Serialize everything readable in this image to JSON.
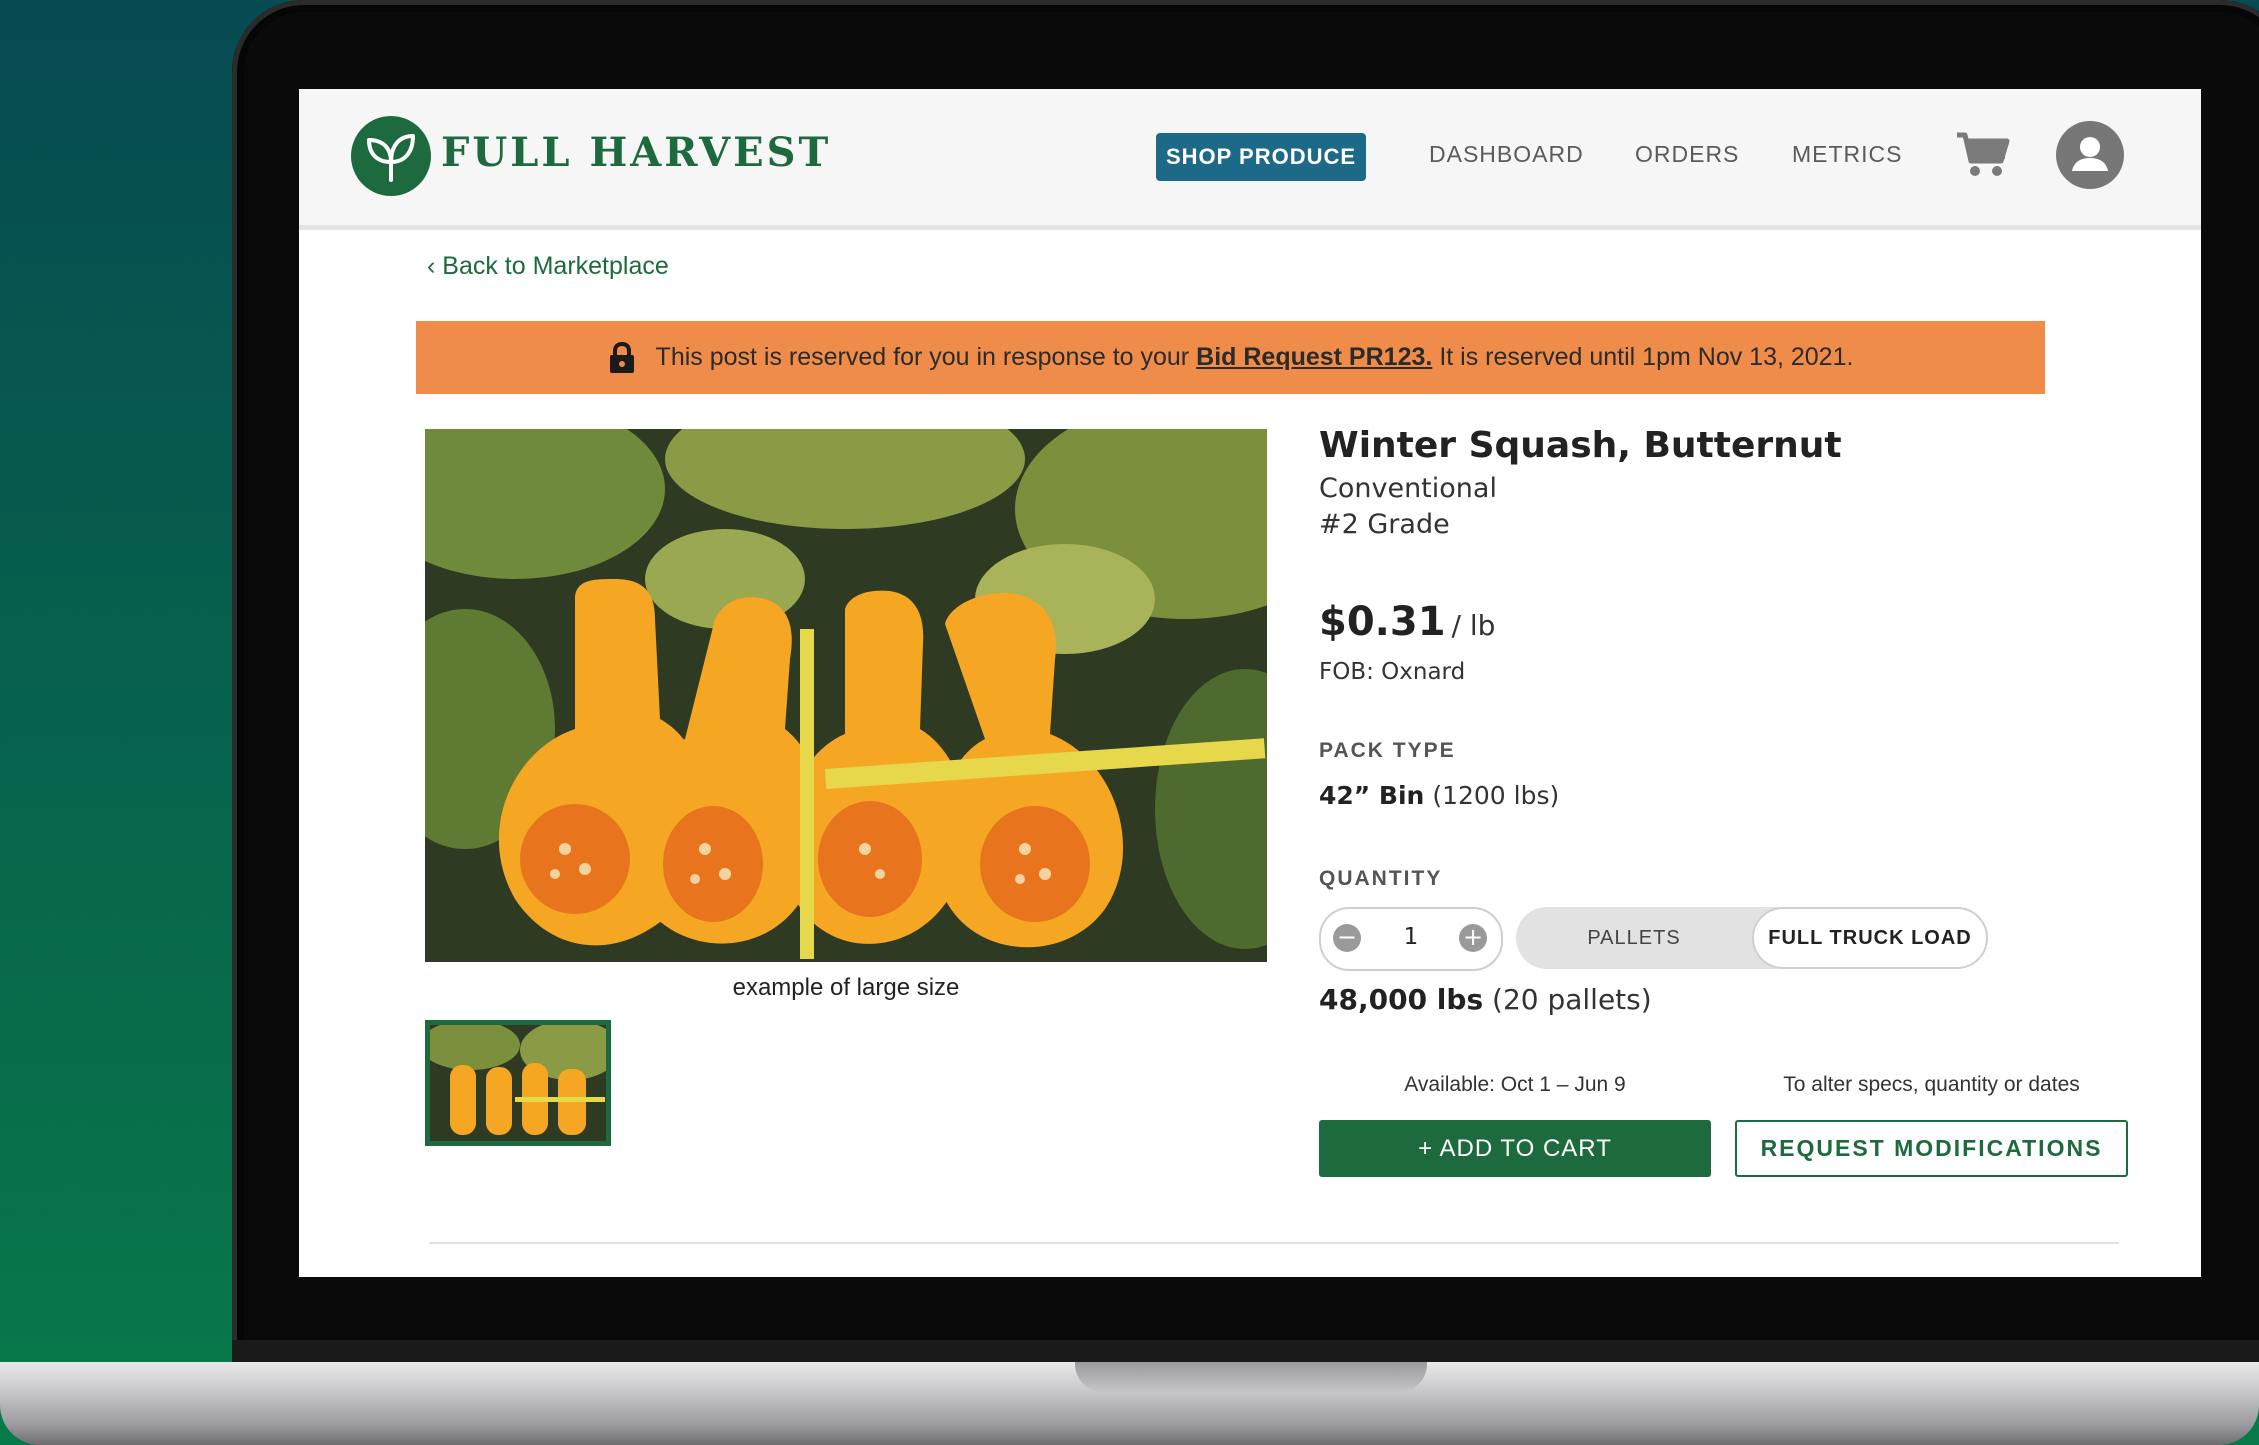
{
  "brand": {
    "name": "FULL HARVEST",
    "color": "#1e6a3f"
  },
  "nav": {
    "items": [
      {
        "label": "SHOP PRODUCE",
        "active": true
      },
      {
        "label": "DASHBOARD",
        "active": false
      },
      {
        "label": "ORDERS",
        "active": false
      },
      {
        "label": "METRICS",
        "active": false
      }
    ],
    "cart_icon": "cart-icon",
    "avatar_icon": "user-avatar-icon"
  },
  "back_link": "‹ Back to Marketplace",
  "banner": {
    "icon": "lock-icon",
    "text_before": "This post is reserved for you in response to your",
    "bid_link": "Bid Request PR123.",
    "text_after": "It is reserved until 1pm Nov 13, 2021.",
    "color": "#f08c49"
  },
  "gallery": {
    "caption": "example of large size"
  },
  "product": {
    "title": "Winter Squash, Butternut",
    "type": "Conventional",
    "grade": "#2 Grade",
    "price": "$0.31",
    "price_unit": "/ lb",
    "fob": "FOB: Oxnard",
    "pack_type_label": "PACK TYPE",
    "pack_type": "42” Bin",
    "pack_weight": "(1200 lbs)",
    "quantity_label": "QUANTITY",
    "quantity": "1",
    "unit_options": [
      "PALLETS",
      "FULL TRUCK LOAD"
    ],
    "selected_unit": "FULL TRUCK LOAD",
    "total_weight": "48,000 lbs",
    "total_pallets": "(20 pallets)",
    "availability": "Available: Oct 1 – Jun 9",
    "alter_hint": "To alter specs, quantity or dates",
    "add_to_cart_label": "+ ADD TO CART",
    "request_mod_label": "REQUEST MODIFICATIONS"
  }
}
